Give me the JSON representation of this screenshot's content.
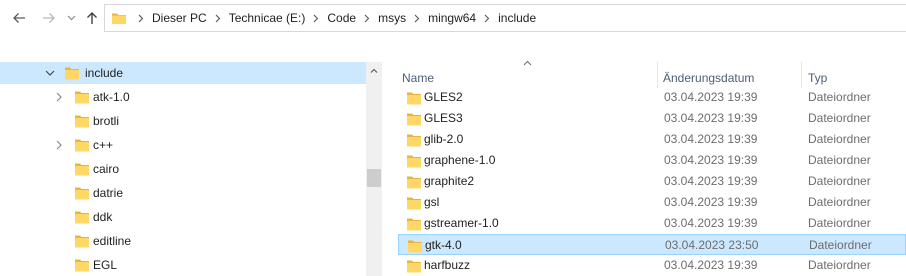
{
  "colors": {
    "folder_body": "#ffd766",
    "folder_tab": "#e8b440",
    "selection_bg": "#cce8ff",
    "selection_border": "#99d1ff",
    "header_text": "#4c607a"
  },
  "nav": {
    "back_icon": "arrow-left-icon",
    "forward_icon": "arrow-right-icon",
    "recent_icon": "chevron-down-icon",
    "up_icon": "arrow-up-icon"
  },
  "address": {
    "crumbs": [
      "Dieser PC",
      "Technicae (E:)",
      "Code",
      "msys",
      "mingw64",
      "include"
    ]
  },
  "tree": {
    "items": [
      {
        "label": "include",
        "expanded": true,
        "selected": true
      },
      {
        "label": "atk-1.0",
        "has_children": true
      },
      {
        "label": "brotli"
      },
      {
        "label": "c++",
        "has_children": true
      },
      {
        "label": "cairo"
      },
      {
        "label": "datrie"
      },
      {
        "label": "ddk"
      },
      {
        "label": "editline"
      },
      {
        "label": "EGL"
      }
    ]
  },
  "list": {
    "columns": {
      "name": "Name",
      "date": "Änderungsdatum",
      "type": "Typ"
    },
    "rows": [
      {
        "name": "GLES2",
        "date": "03.04.2023 19:39",
        "type": "Dateiordner"
      },
      {
        "name": "GLES3",
        "date": "03.04.2023 19:39",
        "type": "Dateiordner"
      },
      {
        "name": "glib-2.0",
        "date": "03.04.2023 19:39",
        "type": "Dateiordner"
      },
      {
        "name": "graphene-1.0",
        "date": "03.04.2023 19:39",
        "type": "Dateiordner"
      },
      {
        "name": "graphite2",
        "date": "03.04.2023 19:39",
        "type": "Dateiordner"
      },
      {
        "name": "gsl",
        "date": "03.04.2023 19:39",
        "type": "Dateiordner"
      },
      {
        "name": "gstreamer-1.0",
        "date": "03.04.2023 19:39",
        "type": "Dateiordner"
      },
      {
        "name": "gtk-4.0",
        "date": "03.04.2023 23:50",
        "type": "Dateiordner",
        "selected": true
      },
      {
        "name": "harfbuzz",
        "date": "03.04.2023 19:39",
        "type": "Dateiordner"
      }
    ]
  }
}
